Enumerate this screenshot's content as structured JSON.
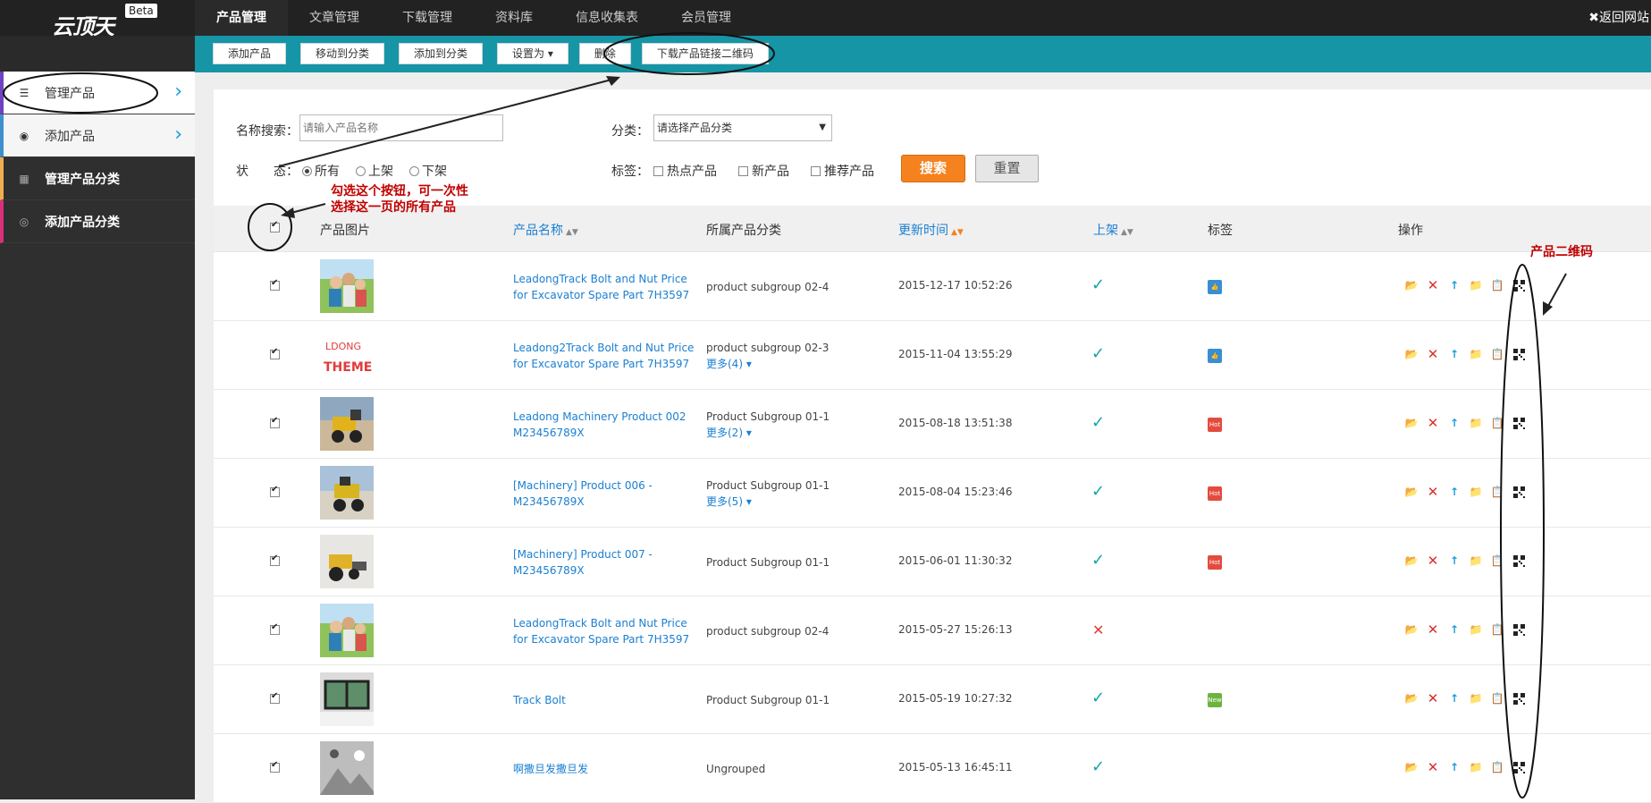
{
  "app": {
    "logo_text": "云顶天",
    "beta": "Beta",
    "back_label": "✖返回网站"
  },
  "top_nav": [
    {
      "label": "产品管理",
      "active": true
    },
    {
      "label": "文章管理"
    },
    {
      "label": "下载管理"
    },
    {
      "label": "资料库"
    },
    {
      "label": "信息收集表"
    },
    {
      "label": "会员管理"
    }
  ],
  "toolbar": {
    "add_product": "添加产品",
    "move_to_category": "移动到分类",
    "add_to_category": "添加到分类",
    "set_as": "设置为",
    "delete": "删除",
    "download_qr": "下载产品链接二维码"
  },
  "sidebar": [
    {
      "label": "管理产品",
      "icon": "list-icon"
    },
    {
      "label": "添加产品",
      "icon": "globe-icon"
    },
    {
      "label": "管理产品分类",
      "icon": "calendar-icon"
    },
    {
      "label": "添加产品分类",
      "icon": "circle-icon"
    }
  ],
  "filters": {
    "name_label": "名称搜索：",
    "name_placeholder": "请输入产品名称",
    "category_label": "分类：",
    "category_value": "请选择产品分类",
    "status_label": "状　　态：",
    "status_options": [
      "所有",
      "上架",
      "下架"
    ],
    "tags_label": "标签：",
    "tag_options": [
      "热点产品",
      "新产品",
      "推荐产品"
    ],
    "search_btn": "搜索",
    "reset_btn": "重置"
  },
  "annotations": {
    "select_all_note_line1": "勾选这个按钮，可一次性",
    "select_all_note_line2": "选择这一页的所有产品",
    "qr_note": "产品二维码"
  },
  "table": {
    "headers": {
      "image": "产品图片",
      "name": "产品名称",
      "category": "所属产品分类",
      "updated": "更新时间",
      "online": "上架",
      "tags": "标签",
      "ops": "操作"
    },
    "rows": [
      {
        "name_line1": "LeadongTrack Bolt and Nut Price",
        "name_line2": "for Excavator Spare Part 7H3597",
        "category": "product subgroup 02-4",
        "more": "",
        "time": "2015-12-17 10:52:26",
        "online": true,
        "tag": "thumbup",
        "thumb": "people"
      },
      {
        "name_line1": "Leadong2Track Bolt and Nut Price",
        "name_line2": "for Excavator Spare Part 7H3597",
        "category": "product subgroup 02-3",
        "more": "更多(4)",
        "time": "2015-11-04 13:55:29",
        "online": true,
        "tag": "thumbup",
        "thumb": "theme"
      },
      {
        "name_line1": "Leadong Machinery Product 002",
        "name_line2": "M23456789X",
        "category": "Product Subgroup 01-1",
        "more": "更多(2)",
        "time": "2015-08-18 13:51:38",
        "online": true,
        "tag": "hot",
        "thumb": "loader"
      },
      {
        "name_line1": "[Machinery] Product 006 -",
        "name_line2": "M23456789X",
        "category": "Product Subgroup 01-1",
        "more": "更多(5)",
        "time": "2015-08-04 15:23:46",
        "online": true,
        "tag": "hot",
        "thumb": "loader2"
      },
      {
        "name_line1": "[Machinery] Product 007 -",
        "name_line2": "M23456789X",
        "category": "Product Subgroup 01-1",
        "more": "",
        "time": "2015-06-01 11:30:32",
        "online": true,
        "tag": "hot",
        "thumb": "loader3"
      },
      {
        "name_line1": "LeadongTrack Bolt and Nut Price",
        "name_line2": "for Excavator Spare Part 7H3597",
        "category": "product subgroup 02-4",
        "more": "",
        "time": "2015-05-27 15:26:13",
        "online": false,
        "tag": "",
        "thumb": "people"
      },
      {
        "name_line1": "Track Bolt",
        "name_line2": "",
        "category": "Product Subgroup 01-1",
        "more": "",
        "time": "2015-05-19 10:27:32",
        "online": true,
        "tag": "new",
        "thumb": "window"
      },
      {
        "name_line1": "啊撒旦发撒旦发",
        "name_line2": "",
        "category": "Ungrouped",
        "more": "",
        "time": "2015-05-13 16:45:11",
        "online": true,
        "tag": "",
        "thumb": "placeholder"
      }
    ]
  },
  "tag_text": {
    "hot": "Hot",
    "new": "New",
    "thumbup": "👍"
  },
  "colors": {
    "toolbar": "#1695a6",
    "accent_orange": "#f5821f",
    "link": "#1b7fd1",
    "annotation": "#c00000"
  }
}
